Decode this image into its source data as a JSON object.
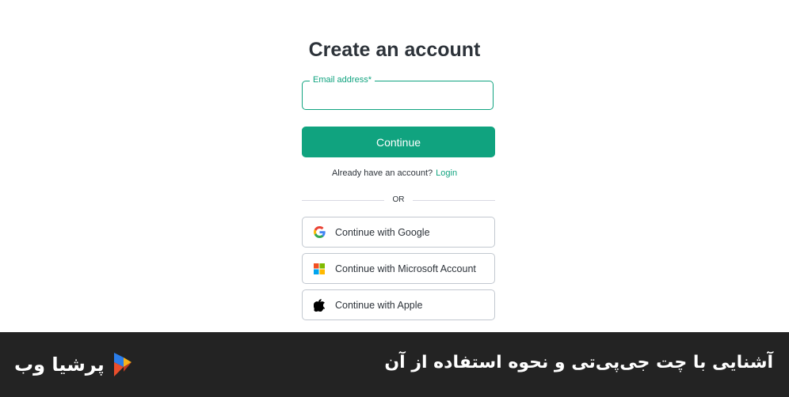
{
  "page": {
    "title": "Create an account"
  },
  "form": {
    "email_label": "Email address*",
    "email_value": "",
    "continue_label": "Continue"
  },
  "signin": {
    "prompt": "Already have an account?",
    "login_link": "Login"
  },
  "divider_text": "OR",
  "social": {
    "google_label": "Continue with Google",
    "microsoft_label": "Continue with Microsoft Account",
    "apple_label": "Continue with Apple"
  },
  "banner": {
    "title": "آشنایی با چت جی‌پی‌تی و نحوه استفاده از آن",
    "brand_name": "پرشیا وب"
  },
  "colors": {
    "accent": "#10a37f",
    "footer_bg": "#232323",
    "border": "#c2c8d0"
  },
  "icons": [
    "google-icon",
    "microsoft-icon",
    "apple-icon",
    "persiaweb-logo-icon"
  ]
}
